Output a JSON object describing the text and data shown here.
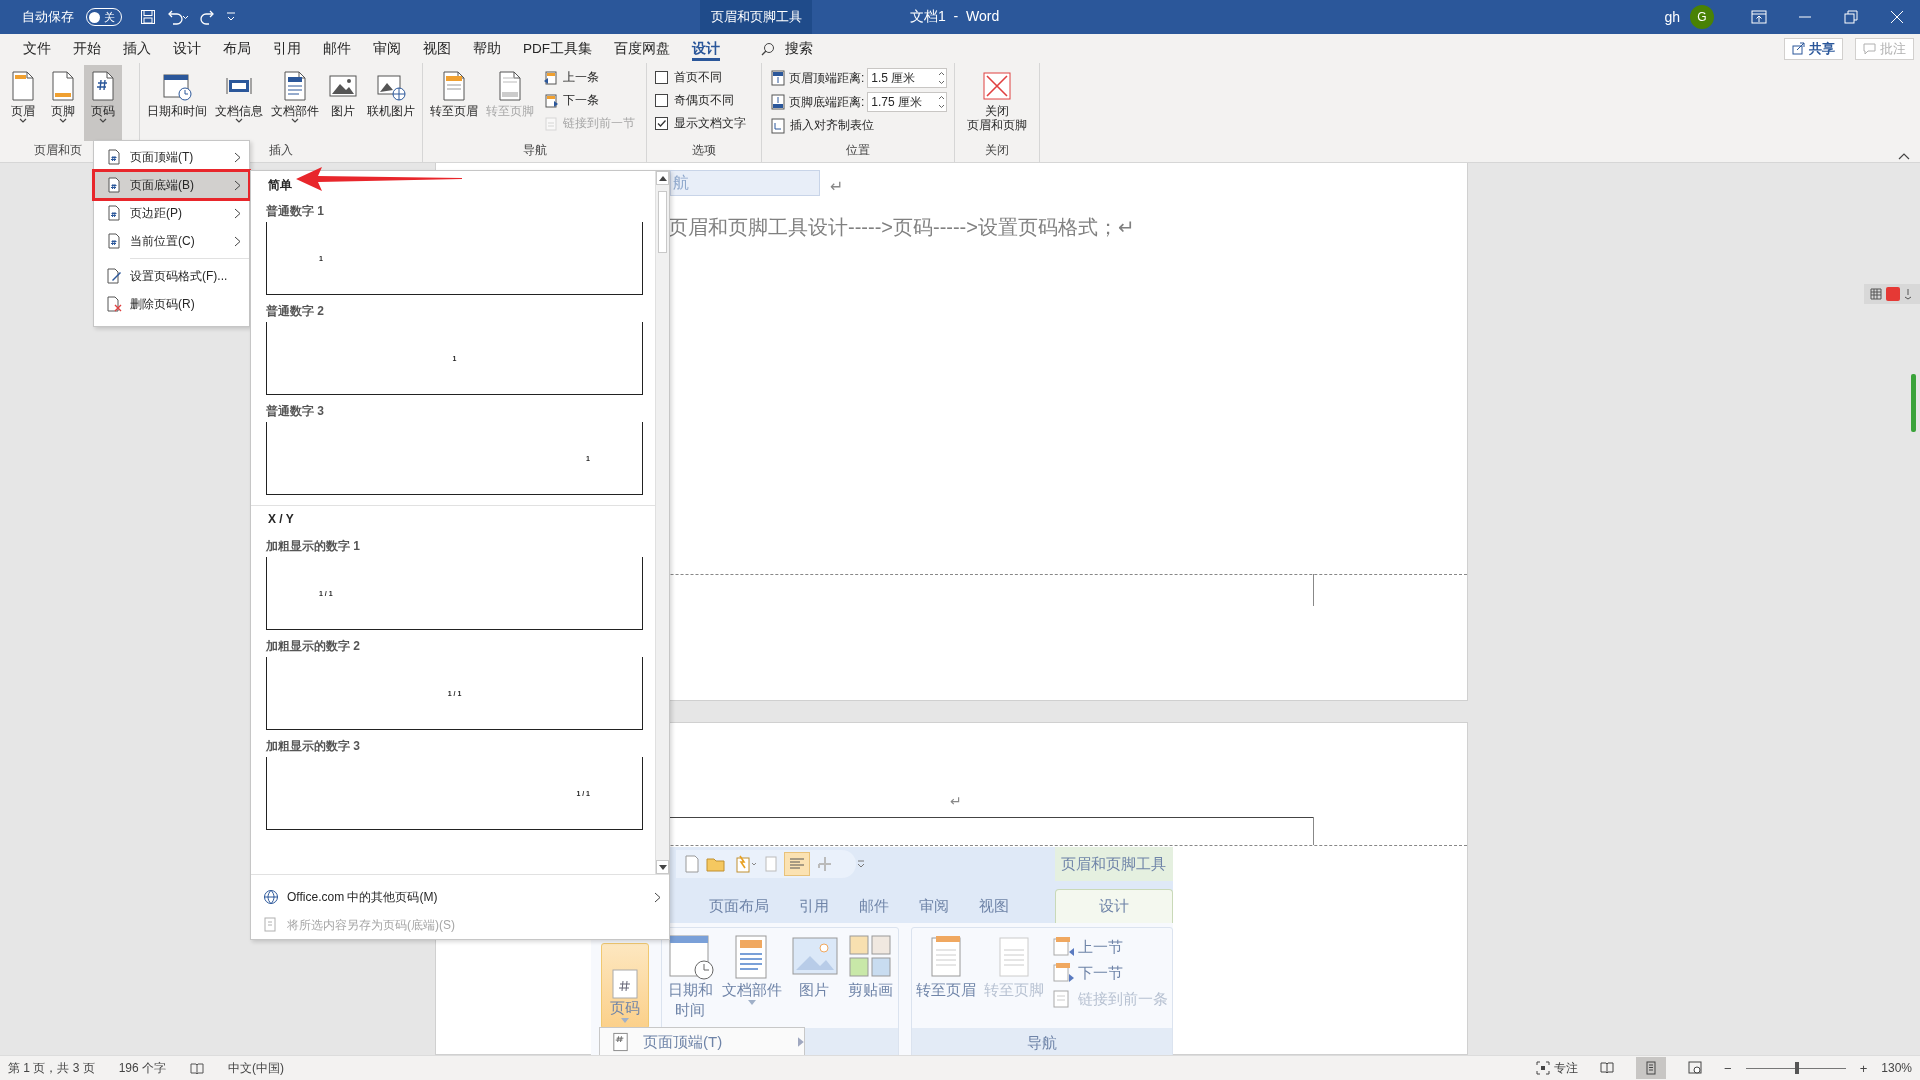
{
  "title_bar": {
    "autosave_label": "自动保存",
    "autosave": {
      "on": false,
      "label": "关"
    },
    "context_tab": "页眉和页脚工具",
    "title": "文档1  -  Word",
    "user": "gh",
    "avatar": "G"
  },
  "tabs": [
    {
      "label": "文件",
      "selected": false
    },
    {
      "label": "开始",
      "selected": false
    },
    {
      "label": "插入",
      "selected": false
    },
    {
      "label": "设计",
      "selected": false
    },
    {
      "label": "布局",
      "selected": false
    },
    {
      "label": "引用",
      "selected": false
    },
    {
      "label": "邮件",
      "selected": false
    },
    {
      "label": "审阅",
      "selected": false
    },
    {
      "label": "视图",
      "selected": false
    },
    {
      "label": "帮助",
      "selected": false
    },
    {
      "label": "PDF工具集",
      "selected": false
    },
    {
      "label": "百度网盘",
      "selected": false
    },
    {
      "label": "设计",
      "selected": true
    }
  ],
  "tell_me": "搜索",
  "share": "共享",
  "comments": {
    "label": "批注",
    "disabled": true
  },
  "ribbon": {
    "groups": [
      {
        "label": "页眉和页",
        "items": [
          {
            "kind": "large",
            "label": "页眉",
            "dropdown": true,
            "pressed": false
          },
          {
            "kind": "large",
            "label": "页脚",
            "dropdown": true,
            "pressed": false
          },
          {
            "kind": "large",
            "label": "页码",
            "dropdown": true,
            "pressed": true
          }
        ]
      },
      {
        "label": "插入",
        "items": [
          {
            "kind": "large",
            "label": "日期和时间",
            "dropdown": false,
            "pressed": false
          },
          {
            "kind": "large",
            "label": "文档信息",
            "dropdown": true,
            "pressed": false
          },
          {
            "kind": "large",
            "label": "文档部件",
            "dropdown": true,
            "pressed": false
          },
          {
            "kind": "large",
            "label": "图片",
            "dropdown": false,
            "pressed": false
          },
          {
            "kind": "large",
            "label": "联机图片",
            "dropdown": false,
            "pressed": false
          }
        ]
      },
      {
        "label": "导航",
        "items": [
          {
            "kind": "large",
            "label": "转至页眉",
            "dropdown": false,
            "disabled": false
          },
          {
            "kind": "large",
            "label": "转至页脚",
            "dropdown": false,
            "disabled": true
          },
          {
            "kind": "stack",
            "items": [
              {
                "kind": "small",
                "label": "上一条",
                "disabled": false
              },
              {
                "kind": "small",
                "label": "下一条",
                "disabled": false
              },
              {
                "kind": "small",
                "label": "链接到前一节",
                "disabled": true
              }
            ]
          }
        ]
      },
      {
        "label": "选项",
        "items": [
          {
            "kind": "stack",
            "items": [
              {
                "kind": "check",
                "label": "首页不同",
                "checked": false
              },
              {
                "kind": "check",
                "label": "奇偶页不同",
                "checked": false
              },
              {
                "kind": "check",
                "label": "显示文档文字",
                "checked": true
              }
            ]
          }
        ]
      },
      {
        "label": "位置",
        "items": [
          {
            "kind": "stack",
            "items": [
              {
                "kind": "spin",
                "label": "页眉顶端距离:",
                "value": "1.5 厘米"
              },
              {
                "kind": "spin",
                "label": "页脚底端距离:",
                "value": "1.75 厘米"
              },
              {
                "kind": "small",
                "label": "插入对齐制表位",
                "disabled": false
              }
            ]
          }
        ]
      },
      {
        "label": "关闭",
        "items": [
          {
            "kind": "large",
            "label_lines": [
              "关闭",
              "页眉和页脚"
            ],
            "dropdown": false,
            "pressed": false
          }
        ]
      }
    ]
  },
  "page_number_menu": {
    "items": [
      {
        "kind": "item",
        "label": "页面顶端(T)",
        "submenu": true,
        "selected": false,
        "highlighted": false
      },
      {
        "kind": "item",
        "label": "页面底端(B)",
        "submenu": true,
        "selected": true,
        "highlighted": true
      },
      {
        "kind": "item",
        "label": "页边距(P)",
        "submenu": true,
        "selected": false,
        "highlighted": false
      },
      {
        "kind": "item",
        "label": "当前位置(C)",
        "submenu": true,
        "selected": false,
        "highlighted": false
      },
      {
        "kind": "separator"
      },
      {
        "kind": "item",
        "label": "设置页码格式(F)...",
        "submenu": false,
        "selected": false,
        "highlighted": false
      },
      {
        "kind": "item",
        "label": "删除页码(R)",
        "submenu": false,
        "selected": false,
        "highlighted": false
      }
    ]
  },
  "gallery": {
    "sections": [
      {
        "heading": "简单",
        "items": [
          {
            "label": "普通数字 1",
            "sample": "1",
            "kind": "left"
          },
          {
            "label": "普通数字 2",
            "sample": "1",
            "kind": "center"
          },
          {
            "label": "普通数字 3",
            "sample": "1",
            "kind": "right"
          }
        ]
      },
      {
        "heading": "X / Y",
        "items": [
          {
            "label": "加粗显示的数字 1",
            "sample": "1 / 1",
            "kind": "left"
          },
          {
            "label": "加粗显示的数字 2",
            "sample": "1 / 1",
            "kind": "center"
          },
          {
            "label": "加粗显示的数字 3",
            "sample": "1 / 1",
            "kind": "right"
          }
        ]
      }
    ],
    "footer": [
      {
        "label": "Office.com 中的其他页码(M)",
        "submenu": true,
        "disabled": false
      },
      {
        "label": "将所选内容另存为页码(底端)(S)",
        "submenu": false,
        "disabled": true
      }
    ]
  },
  "document": {
    "page_1": {
      "image_fragment": "航",
      "return_mark": "↵",
      "paragraph": "页眉和页脚工具设计----->页码----->设置页码格式；↵"
    },
    "page_2": {
      "return_mark": "↵",
      "screenshot": {
        "context_tab": "页眉和页脚工具",
        "tabs": [
          {
            "label": "页面布局",
            "selected": false
          },
          {
            "label": "引用",
            "selected": false
          },
          {
            "label": "邮件",
            "selected": false
          },
          {
            "label": "审阅",
            "selected": false
          },
          {
            "label": "视图",
            "selected": false
          },
          {
            "label": "设计",
            "selected": true
          }
        ],
        "page_number_button": {
          "label": "页码",
          "pressed": true
        },
        "insert_buttons": [
          {
            "label_lines": [
              "日期和",
              "时间"
            ],
            "dropdown": false
          },
          {
            "label": "文档部件",
            "dropdown": true
          },
          {
            "label": "图片",
            "dropdown": false
          },
          {
            "label": "剪贴画",
            "dropdown": false
          }
        ],
        "nav_buttons": [
          {
            "label": "转至页眉",
            "disabled": false
          },
          {
            "label": "转至页脚",
            "disabled": true
          }
        ],
        "nav_small": [
          {
            "label": "上一节",
            "disabled": false
          },
          {
            "label": "下一节",
            "disabled": false
          },
          {
            "label": "链接到前一条",
            "disabled": true
          }
        ],
        "nav_label": "导航",
        "popup_item": "页面顶端(T)"
      }
    }
  },
  "status_bar": {
    "page": "第 1 页，共 3 页",
    "words": "196 个字",
    "language": "中文(中国)",
    "focus": "专注",
    "views": [
      {
        "selected": false
      },
      {
        "selected": true
      },
      {
        "selected": false
      }
    ],
    "zoom_out": "−",
    "zoom": {
      "level": 0.51
    },
    "zoom_in": "+",
    "zoom_percent": "130%"
  }
}
